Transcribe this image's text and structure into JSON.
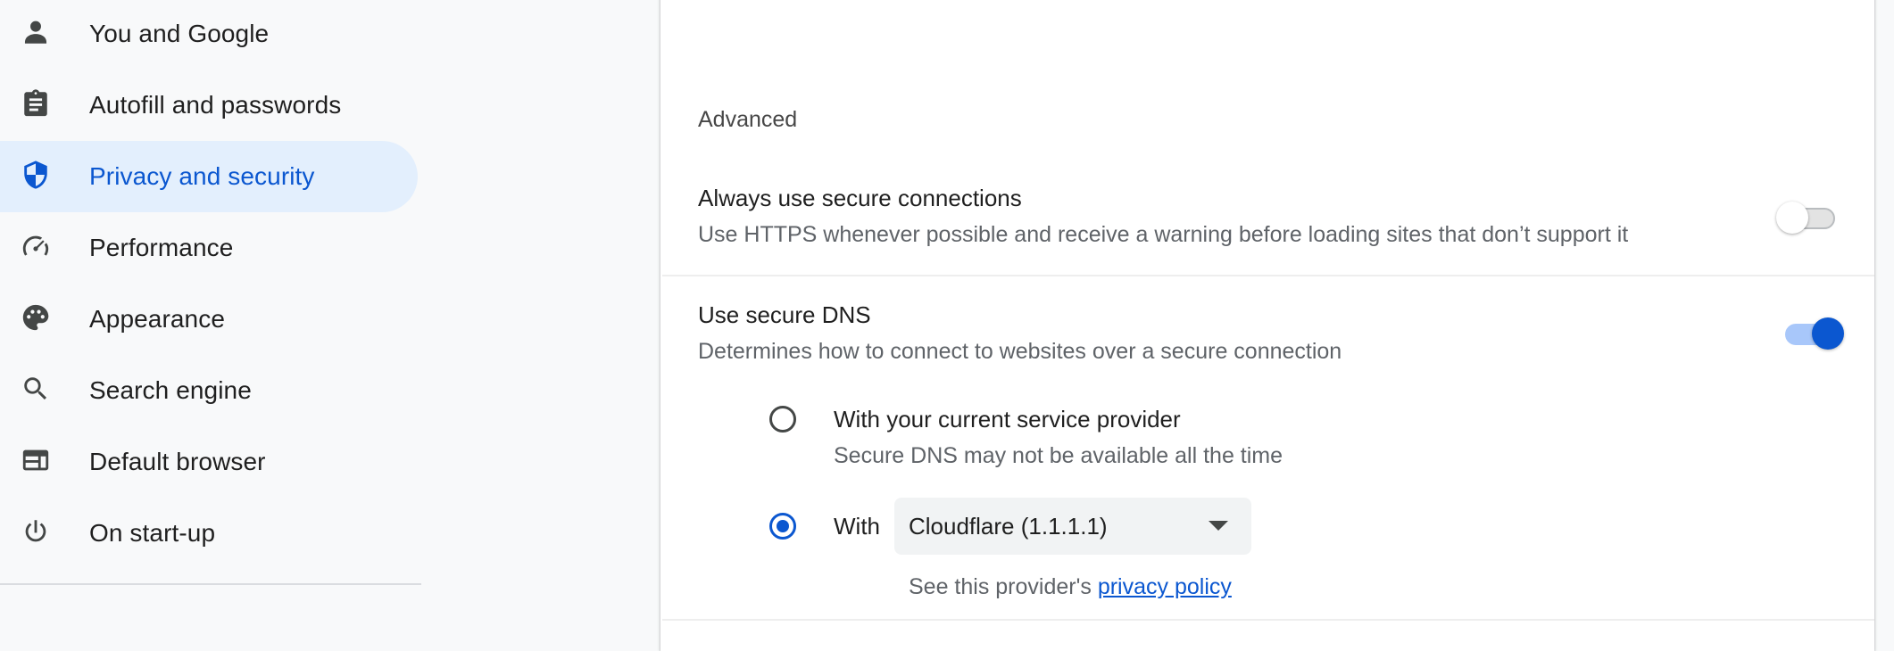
{
  "sidebar": {
    "items": [
      {
        "label": "You and Google",
        "icon": "person-icon"
      },
      {
        "label": "Autofill and passwords",
        "icon": "clipboard-icon"
      },
      {
        "label": "Privacy and security",
        "icon": "shield-icon",
        "active": true
      },
      {
        "label": "Performance",
        "icon": "speedometer-icon"
      },
      {
        "label": "Appearance",
        "icon": "palette-icon"
      },
      {
        "label": "Search engine",
        "icon": "search-icon"
      },
      {
        "label": "Default browser",
        "icon": "browser-window-icon"
      },
      {
        "label": "On start-up",
        "icon": "power-icon"
      }
    ]
  },
  "main": {
    "section_title": "Advanced",
    "secure_connections": {
      "title": "Always use secure connections",
      "subtitle": "Use HTTPS whenever possible and receive a warning before loading sites that don’t support it",
      "enabled": false
    },
    "secure_dns": {
      "title": "Use secure DNS",
      "subtitle": "Determines how to connect to websites over a secure connection",
      "enabled": true,
      "option_current": {
        "label": "With your current service provider",
        "description": "Secure DNS may not be available all the time",
        "selected": false
      },
      "option_custom": {
        "label": "With",
        "selected": true,
        "provider_value": "Cloudflare (1.1.1.1)"
      },
      "provider_note_prefix": "See this provider's ",
      "provider_note_link": "privacy policy"
    }
  },
  "colors": {
    "accent": "#0b57d0",
    "active_bg": "#e3effd",
    "toggle_on_track": "#a8c7fa"
  }
}
